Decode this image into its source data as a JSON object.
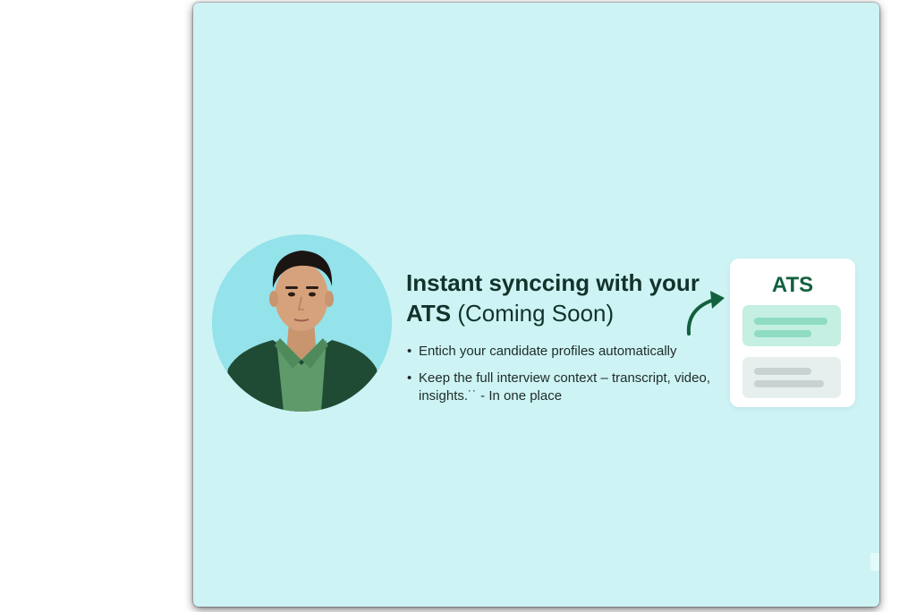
{
  "headline": {
    "main": "Instant synccing with your ATS",
    "suffix": "(Coming Soon)"
  },
  "bullets": [
    {
      "marker": "•",
      "text": "Entich your candidate profiles automatically"
    },
    {
      "marker": "•",
      "text": "Keep the full interview context – transcript, video, insights.˙˙ - In one place"
    }
  ],
  "ats_card": {
    "title": "ATS"
  },
  "colors": {
    "background": "#cef3f4",
    "heading": "#12332a",
    "accent_green": "#13603f",
    "avatar_bg": "#94e2ea"
  },
  "icons": {
    "arrow": "curved-arrow-icon",
    "avatar": "person-avatar"
  }
}
